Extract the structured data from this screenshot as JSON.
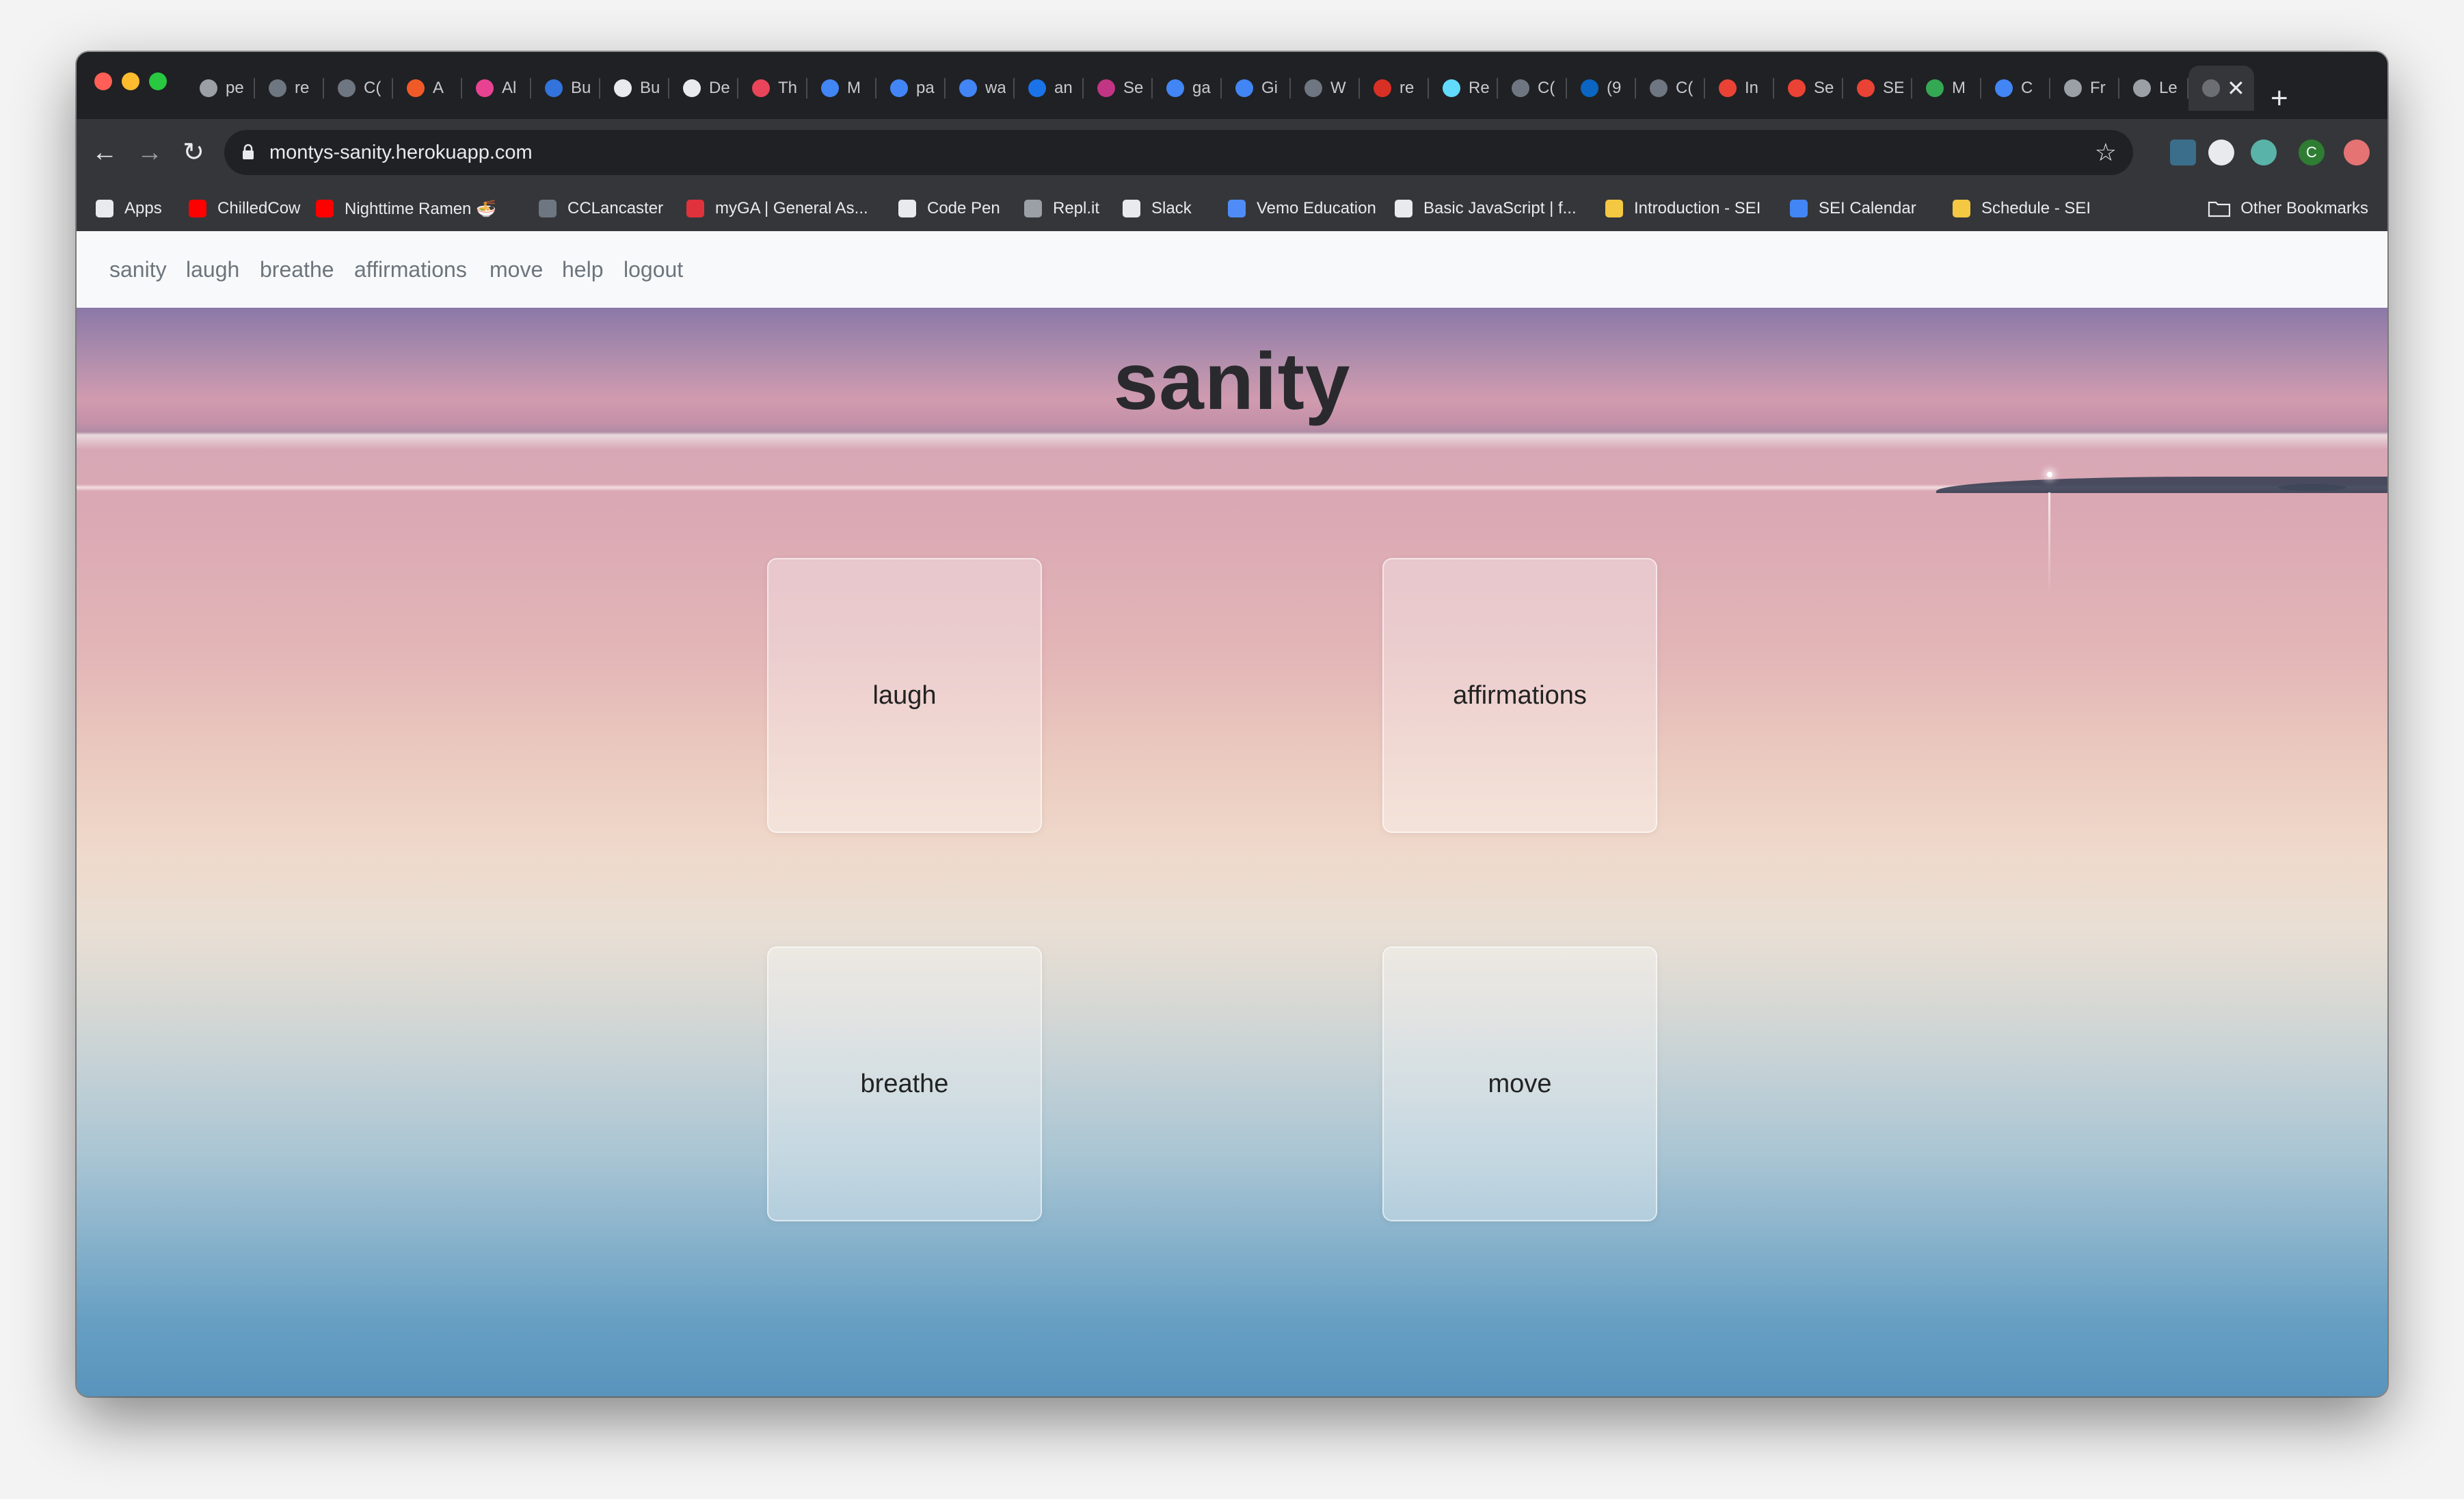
{
  "browser": {
    "tabs": [
      {
        "title": "pe",
        "icon": "cube-icon",
        "color": "#9aa0a6"
      },
      {
        "title": "re",
        "icon": "github-icon",
        "color": "#6e7681"
      },
      {
        "title": "C(",
        "icon": "github-icon",
        "color": "#6e7681"
      },
      {
        "title": "A",
        "icon": "asterisk-icon",
        "color": "#f05a28"
      },
      {
        "title": "Al",
        "icon": "heart-icon",
        "color": "#e84393"
      },
      {
        "title": "Bu",
        "icon": "bulma-icon",
        "color": "#3273dc"
      },
      {
        "title": "Bu",
        "icon": "doc-icon",
        "color": "#e8eaed"
      },
      {
        "title": "De",
        "icon": "doc-icon",
        "color": "#e8eaed"
      },
      {
        "title": "Th",
        "icon": "wave-icon",
        "color": "#e9445a"
      },
      {
        "title": "M",
        "icon": "google-icon",
        "color": "#4285f4"
      },
      {
        "title": "pa",
        "icon": "google-icon",
        "color": "#4285f4"
      },
      {
        "title": "wa",
        "icon": "google-icon",
        "color": "#4285f4"
      },
      {
        "title": "an",
        "icon": "compass-icon",
        "color": "#1a73e8"
      },
      {
        "title": "Se",
        "icon": "instagram-icon",
        "color": "#c13584"
      },
      {
        "title": "ga",
        "icon": "google-icon",
        "color": "#4285f4"
      },
      {
        "title": "Gi",
        "icon": "calendar-icon",
        "color": "#4285f4"
      },
      {
        "title": "W",
        "icon": "github-icon",
        "color": "#6e7681"
      },
      {
        "title": "re",
        "icon": "square-icon",
        "color": "#d93025"
      },
      {
        "title": "Re",
        "icon": "react-icon",
        "color": "#61dafb"
      },
      {
        "title": "C(",
        "icon": "github-icon",
        "color": "#6e7681"
      },
      {
        "title": "(9",
        "icon": "linkedin-icon",
        "color": "#0a66c2"
      },
      {
        "title": "C(",
        "icon": "github-icon",
        "color": "#6e7681"
      },
      {
        "title": "In",
        "icon": "gmail-icon",
        "color": "#ea4335"
      },
      {
        "title": "Se",
        "icon": "gmail-icon",
        "color": "#ea4335"
      },
      {
        "title": "SE",
        "icon": "gmail-icon",
        "color": "#ea4335"
      },
      {
        "title": "M",
        "icon": "drive-icon",
        "color": "#34a853"
      },
      {
        "title": "C",
        "icon": "docs-icon",
        "color": "#4285f4"
      },
      {
        "title": "Fr",
        "icon": "globe-icon",
        "color": "#9aa0a6"
      },
      {
        "title": "Le",
        "icon": "globe-icon",
        "color": "#9aa0a6"
      }
    ],
    "active_tab_icon": "globe-icon",
    "close_glyph": "✕",
    "new_tab_glyph": "+",
    "url": "montys-sanity.herokuapp.com",
    "bookmarks": [
      {
        "label": "Apps",
        "icon": "apps-grid-icon",
        "color": "#e8eaed"
      },
      {
        "label": "ChilledCow",
        "icon": "youtube-icon",
        "color": "#ff0000"
      },
      {
        "label": "Nighttime Ramen 🍜",
        "icon": "youtube-icon",
        "color": "#ff0000"
      },
      {
        "label": "CCLancaster",
        "icon": "github-icon",
        "color": "#6e7681"
      },
      {
        "label": "myGA | General As...",
        "icon": "ga-icon",
        "color": "#e0323c"
      },
      {
        "label": "Code Pen",
        "icon": "codepen-icon",
        "color": "#e8eaed"
      },
      {
        "label": "Repl.it",
        "icon": "replit-icon",
        "color": "#9aa0a6"
      },
      {
        "label": "Slack",
        "icon": "slack-icon",
        "color": "#e8eaed"
      },
      {
        "label": "Vemo Education",
        "icon": "vemo-icon",
        "color": "#4f8cf7"
      },
      {
        "label": "Basic JavaScript | f...",
        "icon": "freecodecamp-icon",
        "color": "#e8eaed"
      },
      {
        "label": "Introduction - SEI",
        "icon": "doc-icon",
        "color": "#f4c842"
      },
      {
        "label": "SEI Calendar",
        "icon": "calendar-icon",
        "color": "#4285f4"
      },
      {
        "label": "Schedule - SEI",
        "icon": "doc-icon",
        "color": "#f4c842"
      }
    ],
    "other_bookmarks": "Other Bookmarks"
  },
  "site": {
    "nav": [
      "sanity",
      "laugh",
      "breathe",
      "affirmations",
      "move",
      "help",
      "logout"
    ],
    "title": "sanity",
    "cards": [
      "laugh",
      "affirmations",
      "breathe",
      "move"
    ]
  },
  "colors": {
    "nav_text": "#6c757d",
    "title_text": "#2a2a2e",
    "browser_chrome": "#202124",
    "toolbar": "#35363a"
  }
}
